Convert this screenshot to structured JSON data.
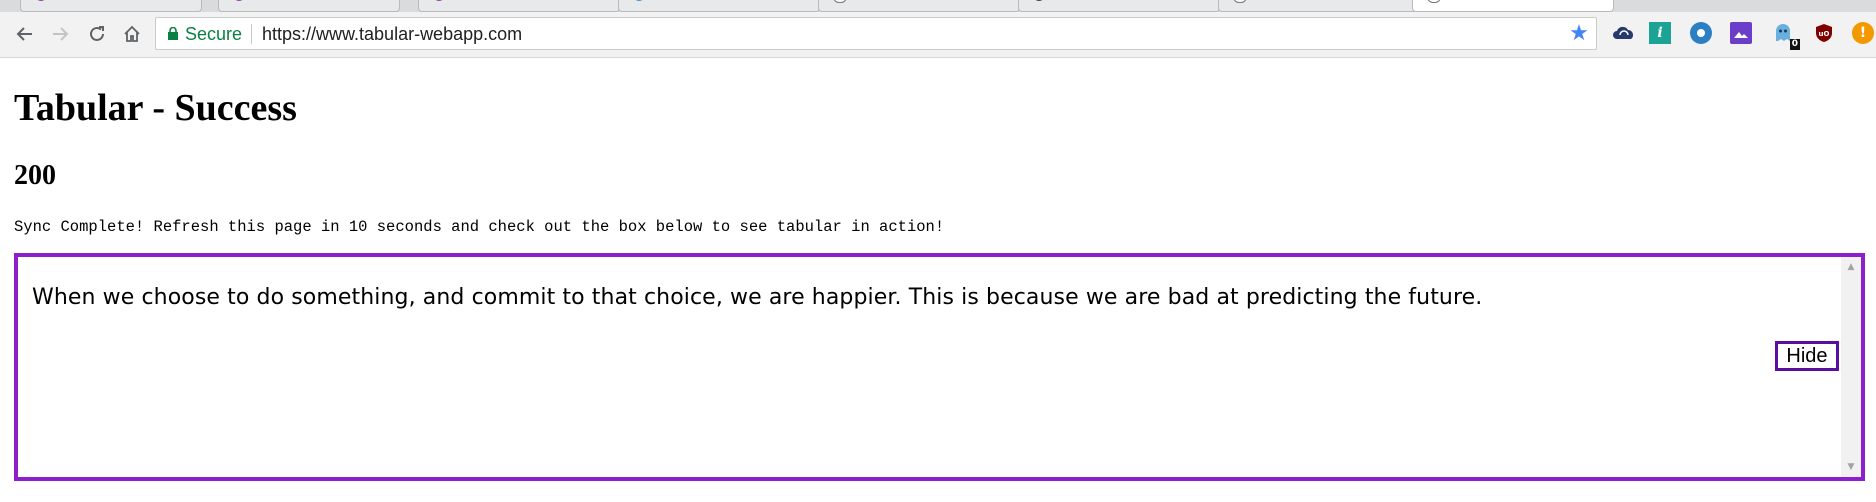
{
  "browser": {
    "secure_label": "Secure",
    "url": "https://www.tabular-webapp.com",
    "bookmark_icon": "star-icon",
    "extensions": [
      {
        "name": "cloud-icon",
        "color": "#263a6b"
      },
      {
        "name": "info-icon",
        "color": "#1ba396",
        "glyph": "i"
      },
      {
        "name": "eye-icon",
        "color": "#2d7fc3"
      },
      {
        "name": "image-icon",
        "color": "#6a3ec8"
      },
      {
        "name": "ghostery-icon",
        "color": "#6ab0de",
        "badge": "0"
      },
      {
        "name": "ublock-icon",
        "color": "#800000"
      },
      {
        "name": "alert-icon",
        "color": "#f29900",
        "glyph": "!"
      }
    ]
  },
  "page": {
    "title": "Tabular - Success",
    "status_code": "200",
    "message": "Sync Complete! Refresh this page in 10 seconds and check out the box below to see tabular in action!"
  },
  "tabular_box": {
    "quote": "When we choose to do something, and commit to that choice, we are happier. This is because we are bad at predicting the future.",
    "hide_label": "Hide",
    "border_color": "#8f1fcc"
  }
}
